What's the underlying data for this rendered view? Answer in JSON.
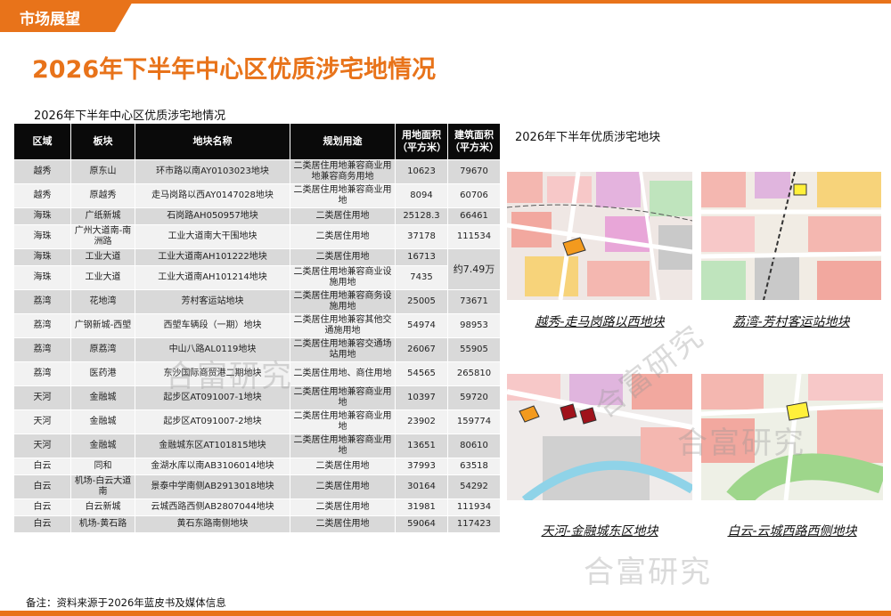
{
  "header": {
    "section_label": "市场展望",
    "title": "2026年下半年中心区优质涉宅地情况"
  },
  "table": {
    "caption": "2026年下半年中心区优质涉宅地情况",
    "headers": [
      "区域",
      "板块",
      "地块名称",
      "规划用途",
      "用地面积\n（平方米）",
      "建筑面积\n（平方米）"
    ],
    "rows": [
      {
        "district": "越秀",
        "sector": "原东山",
        "plot": "环市路以南AY0103023地块",
        "usage": "二类居住用地兼容商业用地兼容商务用地",
        "land_area": "10623",
        "gfa": "79670"
      },
      {
        "district": "越秀",
        "sector": "原越秀",
        "plot": "走马岗路以西AY0147028地块",
        "usage": "二类居住用地兼容商业用地",
        "land_area": "8094",
        "gfa": "60706"
      },
      {
        "district": "海珠",
        "sector": "广纸新城",
        "plot": "石岗路AH050957地块",
        "usage": "二类居住用地",
        "land_area": "25128.3",
        "gfa": "66461"
      },
      {
        "district": "海珠",
        "sector": "广州大道南-南洲路",
        "plot": "工业大道南大干围地块",
        "usage": "二类居住用地",
        "land_area": "37178",
        "gfa": "111534"
      },
      {
        "district": "海珠",
        "sector": "工业大道",
        "plot": "工业大道南AH101222地块",
        "usage": "二类居住用地",
        "land_area": "16713",
        "gfa": "约7.49万"
      },
      {
        "district": "海珠",
        "sector": "工业大道",
        "plot": "工业大道南AH101214地块",
        "usage": "二类居住用地兼容商业设施用地",
        "land_area": "7435",
        "gfa": ""
      },
      {
        "district": "荔湾",
        "sector": "花地湾",
        "plot": "芳村客运站地块",
        "usage": "二类居住用地兼容商务设施用地",
        "land_area": "25005",
        "gfa": "73671"
      },
      {
        "district": "荔湾",
        "sector": "广钢新城-西塱",
        "plot": "西塱车辆段（一期）地块",
        "usage": "二类居住用地兼容其他交通施用地",
        "land_area": "54974",
        "gfa": "98953"
      },
      {
        "district": "荔湾",
        "sector": "原荔湾",
        "plot": "中山八路AL0119地块",
        "usage": "二类居住用地兼容交通场站用地",
        "land_area": "26067",
        "gfa": "55905"
      },
      {
        "district": "荔湾",
        "sector": "医药港",
        "plot": "东沙国际商贸港二期地块",
        "usage": "二类居住用地、商住用地",
        "land_area": "54565",
        "gfa": "265810"
      },
      {
        "district": "天河",
        "sector": "金融城",
        "plot": "起步区AT091007-1地块",
        "usage": "二类居住用地兼容商业用地",
        "land_area": "10397",
        "gfa": "59720"
      },
      {
        "district": "天河",
        "sector": "金融城",
        "plot": "起步区AT091007-2地块",
        "usage": "二类居住用地兼容商业用地",
        "land_area": "23902",
        "gfa": "159774"
      },
      {
        "district": "天河",
        "sector": "金融城",
        "plot": "金融城东区AT101815地块",
        "usage": "二类居住用地兼容商业用地",
        "land_area": "13651",
        "gfa": "80610"
      },
      {
        "district": "白云",
        "sector": "同和",
        "plot": "金湖水库以南AB3106014地块",
        "usage": "二类居住用地",
        "land_area": "37993",
        "gfa": "63518"
      },
      {
        "district": "白云",
        "sector": "机场-白云大道南",
        "plot": "景泰中学南侧AB2913018地块",
        "usage": "二类居住用地",
        "land_area": "30164",
        "gfa": "54292"
      },
      {
        "district": "白云",
        "sector": "白云新城",
        "plot": "云城西路西侧AB2807044地块",
        "usage": "二类居住用地",
        "land_area": "31981",
        "gfa": "111934"
      },
      {
        "district": "白云",
        "sector": "机场-黄石路",
        "plot": "黄石东路南侧地块",
        "usage": "二类居住用地",
        "land_area": "59064",
        "gfa": "117423"
      }
    ]
  },
  "maps": {
    "title": "2026年下半年优质涉宅地块",
    "captions": [
      "越秀-走马岗路以西地块",
      "荔湾-芳村客运站地块",
      "天河-金融城东区地块",
      "白云-云城西路西侧地块"
    ]
  },
  "footnote": "备注：资料来源于2026年蓝皮书及媒体信息",
  "watermark": "合富研究",
  "colors": {
    "accent": "#e8731a",
    "header_bg": "#0a0a0a",
    "row_dark": "#d9d9d9",
    "row_light": "#f2f2f2"
  }
}
